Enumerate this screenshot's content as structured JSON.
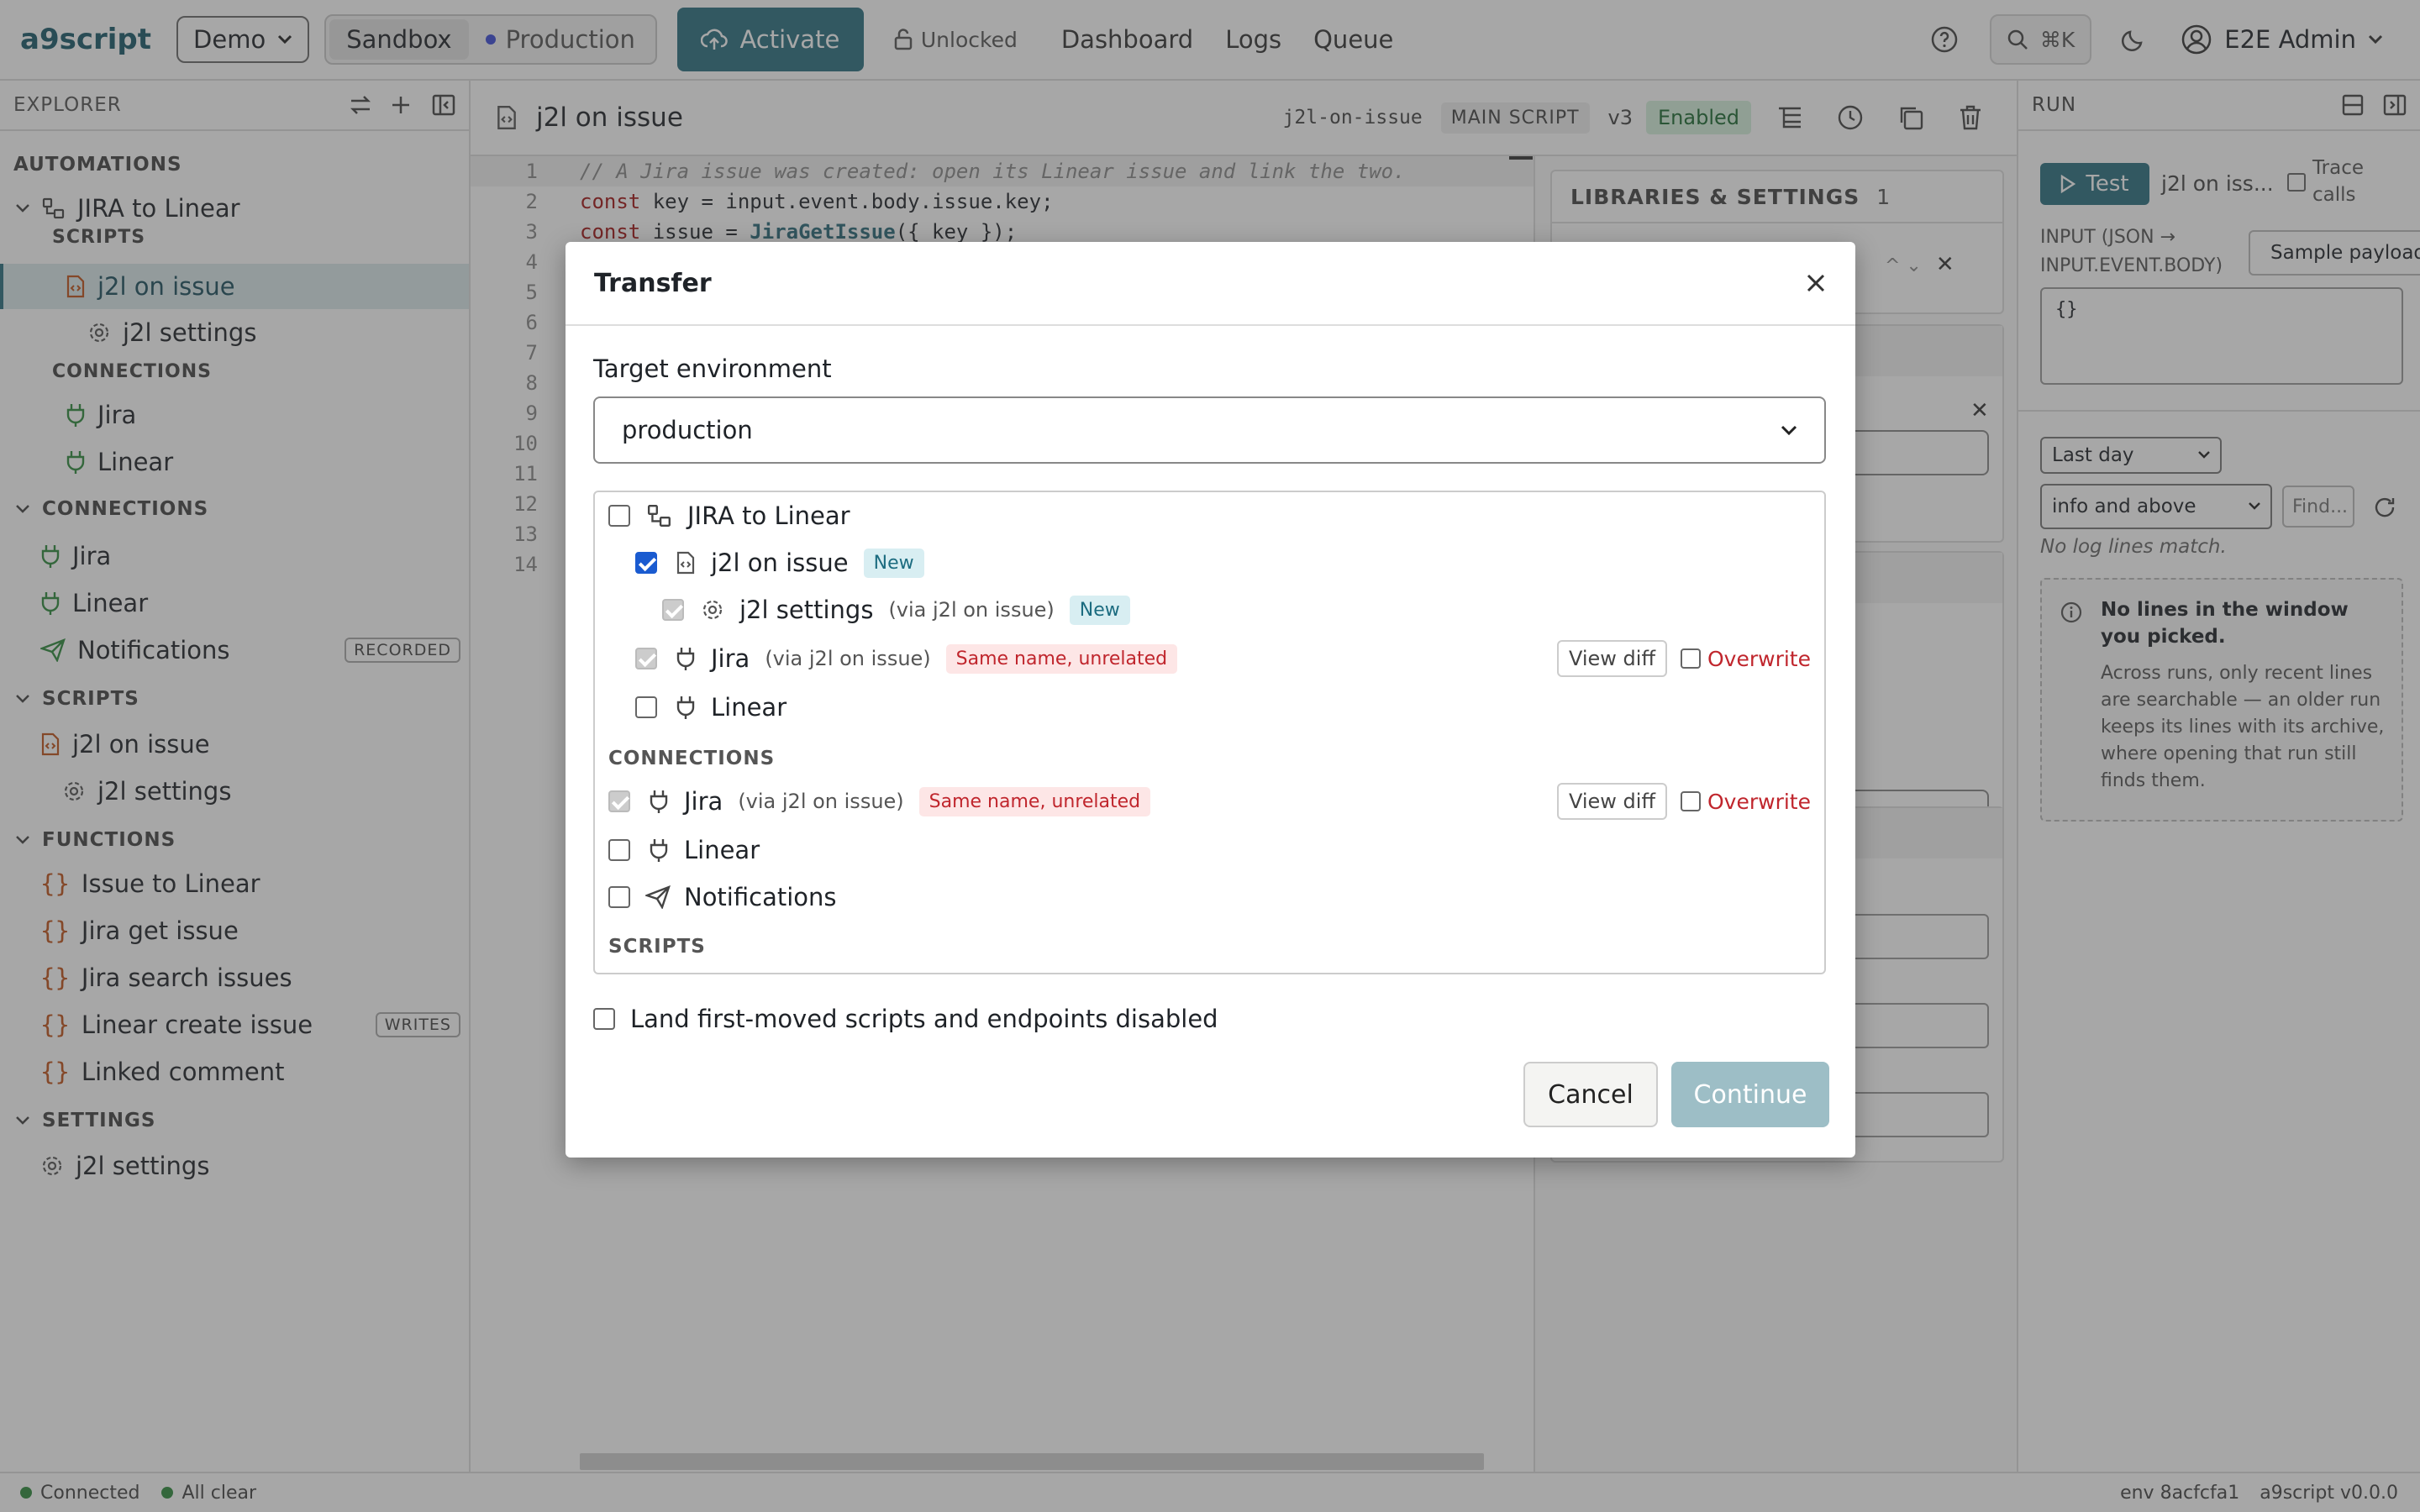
{
  "topbar": {
    "logo": "a9script",
    "workspace_select": "Demo",
    "env_sandbox": "Sandbox",
    "env_production": "Production",
    "activate": "Activate",
    "unlocked": "Unlocked",
    "nav": [
      "Dashboard",
      "Logs",
      "Queue"
    ],
    "search_shortcut": "⌘K",
    "user": "E2E Admin"
  },
  "sidebar": {
    "title": "EXPLORER",
    "automations_label": "AUTOMATIONS",
    "automation": "JIRA to Linear",
    "scripts_sub": "SCRIPTS",
    "script_main": "j2l on issue",
    "script_settings": "j2l settings",
    "connections_sub": "CONNECTIONS",
    "conn_jira": "Jira",
    "conn_linear": "Linear",
    "connections_label": "CONNECTIONS",
    "connections": [
      "Jira",
      "Linear",
      "Notifications"
    ],
    "recorded": "RECORDED",
    "scripts_label": "SCRIPTS",
    "scripts": [
      "j2l on issue",
      "j2l settings"
    ],
    "functions_label": "FUNCTIONS",
    "functions": [
      "Issue to Linear",
      "Jira get issue",
      "Jira search issues",
      "Linear create issue",
      "Linked comment"
    ],
    "writes": "WRITES",
    "settings_label": "SETTINGS",
    "settings": [
      "j2l settings"
    ]
  },
  "editor": {
    "title": "j2l on issue",
    "slug": "j2l-on-issue",
    "main_script": "MAIN SCRIPT",
    "version": "v3",
    "enabled": "Enabled",
    "line_numbers": [
      "1",
      "2",
      "3",
      "4",
      "5",
      "6",
      "7",
      "8",
      "9",
      "10",
      "11",
      "12",
      "13",
      "14"
    ],
    "line1": "// A Jira issue was created: open its Linear issue and link the two.",
    "line2a": "const",
    "line2b": " key = input.event.body.issue.key;",
    "line3a": "const",
    "line3b": " issue = ",
    "line3c": "JiraGetIssue",
    "line3d": "({ key });",
    "libs_title": "LIBRARIES & SETTINGS",
    "libs_count": "1"
  },
  "run": {
    "title": "RUN",
    "test": "Test",
    "test_target": "j2l on iss...",
    "trace": "Trace calls",
    "input_label": "INPUT (JSON → INPUT.EVENT.BODY)",
    "sample": "Sample payload...",
    "input_value": "{}",
    "range": "Last day",
    "level": "info and above",
    "find_placeholder": "Find...",
    "no_lines": "No log lines match.",
    "info_title": "No lines in the window you picked.",
    "info_body": "Across runs, only recent lines are searchable — an older run keeps its lines with its archive, where opening that run still finds them."
  },
  "modal": {
    "title": "Transfer",
    "target_label": "Target environment",
    "target_value": "production",
    "tree": {
      "automation": "JIRA to Linear",
      "script": "j2l on issue",
      "script_tag": "New",
      "settings": "j2l settings",
      "settings_via": "(via j2l on issue)",
      "settings_tag": "New",
      "jira": "Jira",
      "jira_via": "(via j2l on issue)",
      "jira_warn": "Same name, unrelated",
      "view_diff": "View diff",
      "overwrite": "Overwrite",
      "linear": "Linear",
      "connections_label": "CONNECTIONS",
      "c_jira": "Jira",
      "c_jira_via": "(via j2l on issue)",
      "c_jira_warn": "Same name, unrelated",
      "c_view_diff": "View diff",
      "c_overwrite": "Overwrite",
      "c_linear": "Linear",
      "c_notifications": "Notifications",
      "scripts_label": "SCRIPTS"
    },
    "land_disabled": "Land first-moved scripts and endpoints disabled",
    "cancel": "Cancel",
    "continue": "Continue"
  },
  "footer": {
    "connected": "Connected",
    "all_clear": "All clear",
    "env": "env 8acfcfa1",
    "version": "a9script v0.0.0"
  }
}
